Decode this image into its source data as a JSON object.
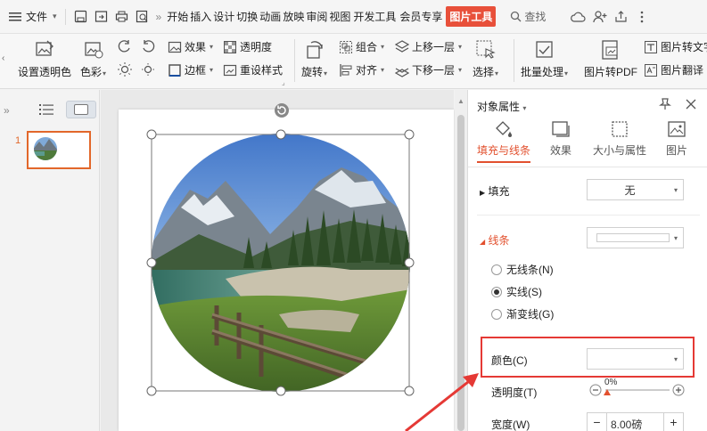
{
  "menubar": {
    "file_label": "文件",
    "tabs": [
      "开始",
      "插入",
      "设计",
      "切换",
      "动画",
      "放映",
      "审阅",
      "视图",
      "开发工具",
      "会员专享"
    ],
    "active_tab": "图片工具",
    "search_label": "查找",
    "more_label": "»"
  },
  "ribbon": {
    "set_transparent": "设置透明色",
    "color": "色彩",
    "effects": "效果",
    "transparency": "透明度",
    "border": "边框",
    "reset_style": "重设样式",
    "rotate": "旋转",
    "group": "组合",
    "align": "对齐",
    "bring_forward": "上移一层",
    "send_backward": "下移一层",
    "select": "选择",
    "batch": "批量处理",
    "to_pdf": "图片转PDF",
    "to_text": "图片转文字",
    "translate": "图片翻译"
  },
  "leftpane": {
    "slide_number": "1"
  },
  "panel": {
    "title": "对象属性",
    "tabs": [
      "填充与线条",
      "效果",
      "大小与属性",
      "图片"
    ],
    "fill_label": "填充",
    "fill_value": "无",
    "line_label": "线条",
    "line_options": [
      "无线条(N)",
      "实线(S)",
      "渐变线(G)"
    ],
    "selected_line_option": "实线(S)",
    "color_label": "颜色(C)",
    "color_value": "",
    "transparency_label": "透明度(T)",
    "transparency_value": "0%",
    "width_label": "宽度(W)",
    "width_value": "8.00磅"
  },
  "colors": {
    "accent": "#e2502e",
    "highlight_box": "#e53935",
    "active_tab_bg": "#e8503a"
  }
}
